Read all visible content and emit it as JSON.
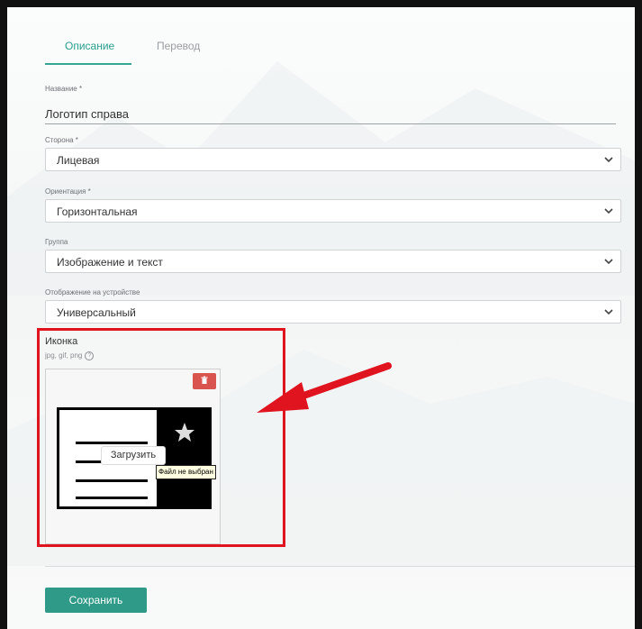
{
  "tabs": [
    {
      "label": "Описание",
      "active": true
    },
    {
      "label": "Перевод",
      "active": false
    }
  ],
  "form": {
    "name": {
      "label": "Название *",
      "value": "Логотип справа"
    },
    "side": {
      "label": "Сторона *",
      "value": "Лицевая"
    },
    "orientation": {
      "label": "Ориентация *",
      "value": "Горизонтальная"
    },
    "group": {
      "label": "Группа",
      "value": "Изображение и текст"
    },
    "display": {
      "label": "Отображение на устройстве",
      "value": "Универсальный"
    },
    "icon": {
      "title": "Иконка",
      "hint": "jpg, gif, png",
      "help_glyph": "?",
      "upload_label": "Загрузить",
      "file_status": "Файл не выбран"
    }
  },
  "actions": {
    "save_label": "Сохранить"
  },
  "colors": {
    "accent": "#2aa08e",
    "save_button": "#2f9a87",
    "delete_button": "#d9534f",
    "annotation_red": "#e0141e"
  },
  "icons": [
    "chevron-down-icon",
    "trash-icon",
    "star-icon",
    "help-icon",
    "annotation-arrow-icon"
  ]
}
